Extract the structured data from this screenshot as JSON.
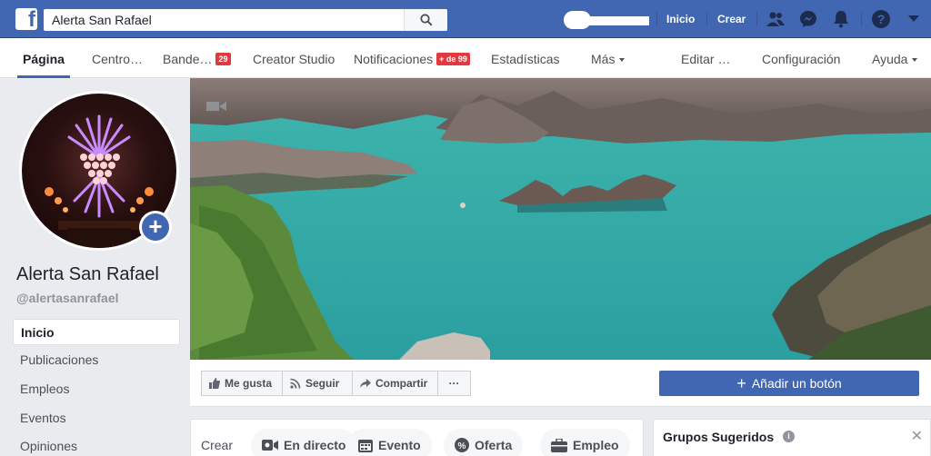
{
  "topbar": {
    "search_value": "Alerta San Rafael",
    "links": [
      "Inicio",
      "Crear"
    ]
  },
  "page_nav": {
    "items": [
      {
        "label": "Página"
      },
      {
        "label": "Centro…"
      },
      {
        "label": "Bande…",
        "badge": "29"
      },
      {
        "label": "Creator Studio"
      },
      {
        "label": "Notificaciones",
        "badge": "+ de 99"
      },
      {
        "label": "Estadísticas"
      },
      {
        "label": "Más"
      },
      {
        "label": "Editar …"
      },
      {
        "label": "Configuración"
      },
      {
        "label": "Ayuda"
      }
    ]
  },
  "profile": {
    "name": "Alerta San Rafael",
    "handle": "@alertasanrafael"
  },
  "sidebar": {
    "items": [
      {
        "label": "Inicio"
      },
      {
        "label": "Publicaciones"
      },
      {
        "label": "Empleos"
      },
      {
        "label": "Eventos"
      },
      {
        "label": "Opiniones"
      }
    ]
  },
  "actions": {
    "like": "Me gusta",
    "follow": "Seguir",
    "share": "Compartir",
    "more": "···",
    "add_button": "Añadir un botón"
  },
  "create": {
    "label": "Crear",
    "items": [
      "En directo",
      "Evento",
      "Oferta",
      "Empleo"
    ]
  },
  "groups": {
    "title": "Grupos Sugeridos"
  },
  "colors": {
    "brand": "#4267b2",
    "badge": "#e0393e"
  }
}
